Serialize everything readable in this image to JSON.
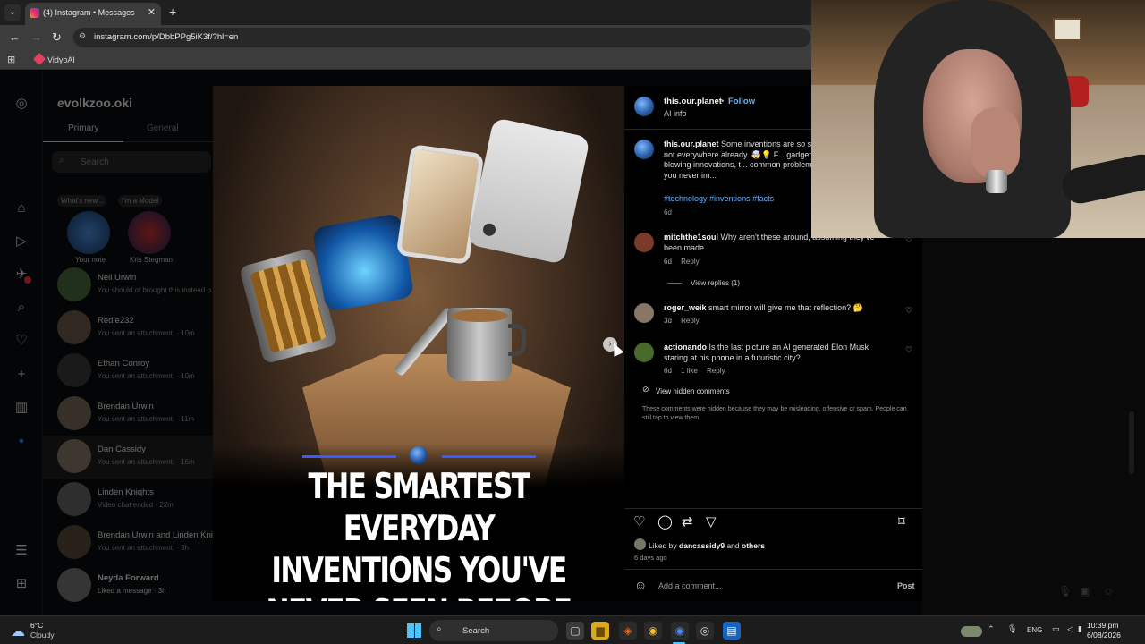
{
  "browser": {
    "tab_title": "(4) Instagram • Messages",
    "url": "instagram.com/p/DbbPPg5iK3f/?hl=en",
    "bookmark": "VidyoAI"
  },
  "dm": {
    "username": "evolkzoo.oki",
    "tabs": [
      "Primary",
      "General"
    ],
    "search_placeholder": "Search",
    "notes": [
      {
        "bubble": "What's new...",
        "name": "Your note"
      },
      {
        "bubble": "I'm a Model",
        "name": "Kris Stegman"
      }
    ],
    "conversations": [
      {
        "name": "Neil Urwin",
        "preview": "You should of brought this instead o..."
      },
      {
        "name": "Redie232",
        "preview": "You sent an attachment. · 10m"
      },
      {
        "name": "Ethan Conroy",
        "preview": "You sent an attachment. · 10m"
      },
      {
        "name": "Brendan Urwin",
        "preview": "You sent an attachment. · 11m"
      },
      {
        "name": "Dan Cassidy",
        "preview": "You sent an attachment. · 16m"
      },
      {
        "name": "Linden Knights",
        "preview": "Video chat ended · 22m"
      },
      {
        "name": "Brendan Urwin and Linden Knights",
        "preview": "You sent an attachment. · 3h"
      },
      {
        "name": "Neyda Forward",
        "preview": "Liked a message · 3h"
      }
    ]
  },
  "post": {
    "image_caption": "THE SMARTEST EVERYDAY INVENTIONS YOU'VE NEVER SEEN BEFORE",
    "author": "this.our.planet",
    "follow": "Follow",
    "ai_info": "AI info",
    "caption_author": "this.our.planet",
    "caption_text": "Some inventions are so s... they're not everywhere already. 🤯💡 F... gadgets to mind-blowing innovations, t... common problems in ways you never im...",
    "hashtags": "#technology #inventions #facts",
    "caption_time": "6d",
    "comments": [
      {
        "user": "mitchthe1soul",
        "text": "Why aren't these around, assuming they've been made.",
        "time": "6d",
        "likes": "",
        "reply": "Reply"
      },
      {
        "user": "roger_weik",
        "text": "smart mirror will give me that reflection? 🤔",
        "time": "3d",
        "likes": "",
        "reply": "Reply"
      },
      {
        "user": "actionando",
        "text": "Is the last picture an AI generated Elon Musk staring at his phone in a futuristic city?",
        "time": "6d",
        "likes": "1 like",
        "reply": "Reply"
      }
    ],
    "view_replies": "View replies (1)",
    "view_hidden": "View hidden comments",
    "hidden_note": "These comments were hidden because they may be misleading, offensive or spam. People can still tap to view them.",
    "liked_by_prefix": "Liked by",
    "liked_by_user": "dancassidy9",
    "liked_by_and": "and",
    "liked_by_others": "others",
    "time_ago": "6 days ago",
    "add_comment_placeholder": "Add a comment...",
    "post_button": "Post"
  },
  "taskbar": {
    "temp": "6°C",
    "weather": "Cloudy",
    "search": "Search",
    "lang": "ENG",
    "time": "10:39 pm",
    "date": "6/08/2026"
  }
}
